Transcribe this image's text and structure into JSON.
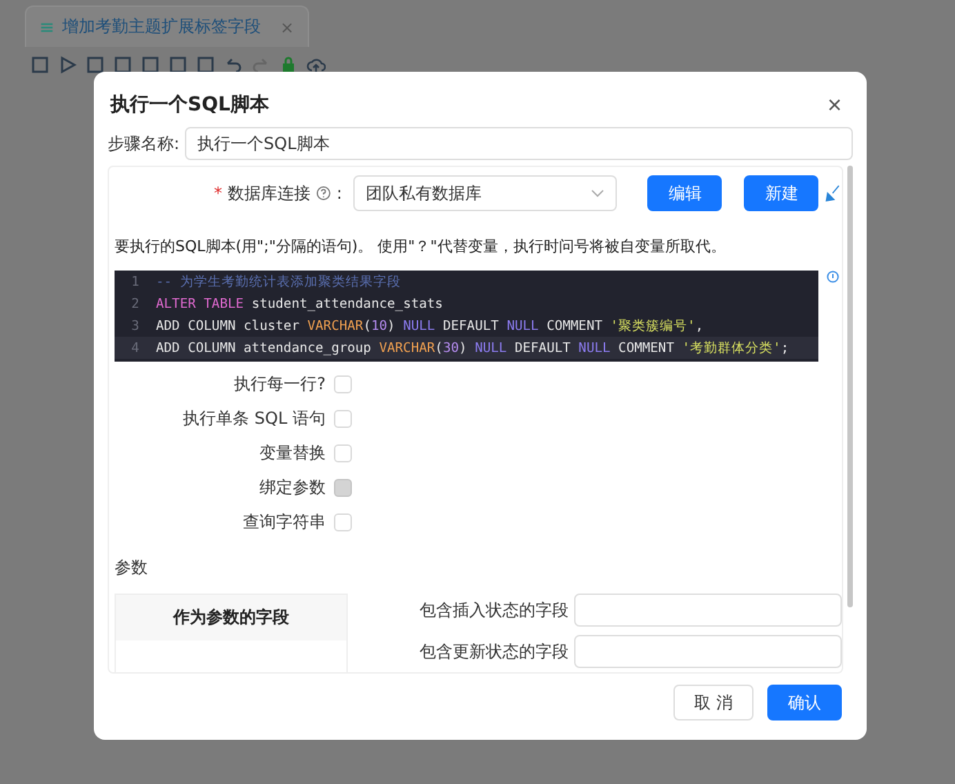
{
  "background": {
    "tab": {
      "label": "增加考勤主题扩展标签字段",
      "close": "×"
    }
  },
  "dialog": {
    "title": "执行一个SQL脚本",
    "close": "×",
    "step_name": {
      "label": "步骤名称:",
      "value": "执行一个SQL脚本"
    },
    "connection": {
      "required": "*",
      "label": "数据库连接",
      "colon": ":",
      "value": "团队私有数据库",
      "buttons": [
        "编辑",
        "新建"
      ]
    },
    "hint": "要执行的SQL脚本(用\";\"分隔的语句)。 使用\"？\"代替变量，执行时问号将被自变量所取代。",
    "code": [
      {
        "number": "1",
        "tokens": [
          {
            "kind": "comment",
            "text": "-- 为学生考勤统计表添加聚类结果字段"
          }
        ]
      },
      {
        "number": "2",
        "tokens": [
          {
            "kind": "keyword",
            "text": "ALTER TABLE"
          },
          {
            "kind": "plain",
            "text": " student_attendance_stats"
          }
        ]
      },
      {
        "number": "3",
        "tokens": [
          {
            "kind": "plain",
            "text": "ADD COLUMN cluster "
          },
          {
            "kind": "type",
            "text": "VARCHAR"
          },
          {
            "kind": "plain",
            "text": "("
          },
          {
            "kind": "number",
            "text": "10"
          },
          {
            "kind": "plain",
            "text": ") "
          },
          {
            "kind": "null",
            "text": "NULL"
          },
          {
            "kind": "plain",
            "text": " DEFAULT "
          },
          {
            "kind": "null",
            "text": "NULL"
          },
          {
            "kind": "plain",
            "text": " COMMENT "
          },
          {
            "kind": "string",
            "text": "'聚类簇编号'"
          },
          {
            "kind": "plain",
            "text": ","
          }
        ]
      },
      {
        "number": "4",
        "tokens": [
          {
            "kind": "plain",
            "text": "ADD COLUMN attendance_group "
          },
          {
            "kind": "type",
            "text": "VARCHAR"
          },
          {
            "kind": "plain",
            "text": "("
          },
          {
            "kind": "number",
            "text": "30"
          },
          {
            "kind": "plain",
            "text": ") "
          },
          {
            "kind": "null",
            "text": "NULL"
          },
          {
            "kind": "plain",
            "text": " DEFAULT "
          },
          {
            "kind": "null",
            "text": "NULL"
          },
          {
            "kind": "plain",
            "text": " COMMENT "
          },
          {
            "kind": "string",
            "text": "'考勤群体分类'"
          },
          {
            "kind": "plain",
            "text": ";"
          }
        ]
      }
    ],
    "options": [
      {
        "label": "执行每一行?",
        "checked": false,
        "disabled": false
      },
      {
        "label": "执行单条 SQL 语句",
        "checked": false,
        "disabled": false
      },
      {
        "label": "变量替换",
        "checked": false,
        "disabled": false
      },
      {
        "label": "绑定参数",
        "checked": false,
        "disabled": true
      },
      {
        "label": "查询字符串",
        "checked": false,
        "disabled": false
      }
    ],
    "params": {
      "title": "参数",
      "table_header": "作为参数的字段",
      "fields": [
        {
          "label": "包含插入状态的字段"
        },
        {
          "label": "包含更新状态的字段"
        }
      ]
    },
    "footer": {
      "cancel": "取 消",
      "confirm": "确认"
    }
  }
}
